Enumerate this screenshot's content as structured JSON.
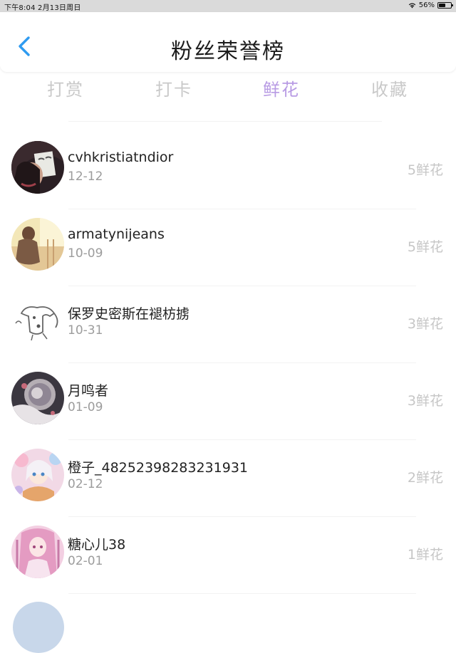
{
  "status_bar": {
    "time_date": "下午8:04   2月13日周日",
    "battery": "56%",
    "battery_level": 0.56
  },
  "header": {
    "title": "粉丝荣誉榜",
    "back_icon": "chevron-left-icon",
    "accent_color": "#2f9bf0"
  },
  "tabs": [
    {
      "label": "打赏",
      "active": false
    },
    {
      "label": "打卡",
      "active": false
    },
    {
      "label": "鲜花",
      "active": true
    },
    {
      "label": "收藏",
      "active": false
    }
  ],
  "active_tab_color": "#b89be4",
  "fans": [
    {
      "name": "cvhkristiatndior",
      "date": "12-12",
      "count": "5鲜花"
    },
    {
      "name": "armatynijeans",
      "date": "10-09",
      "count": "5鲜花"
    },
    {
      "name": "保罗史密斯在褪枋掳",
      "date": "10-31",
      "count": "3鲜花"
    },
    {
      "name": "月鸣者",
      "date": "01-09",
      "count": "3鲜花"
    },
    {
      "name": "橙子_48252398283231931",
      "date": "02-12",
      "count": "2鲜花"
    },
    {
      "name": "糖心儿38",
      "date": "02-01",
      "count": "1鲜花"
    }
  ]
}
